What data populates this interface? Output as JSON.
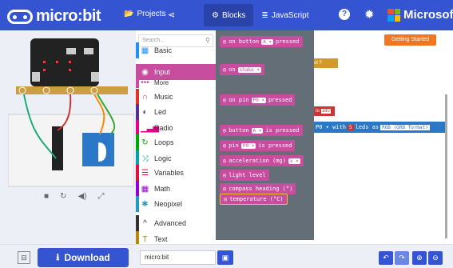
{
  "header": {
    "brand": "micro:bit",
    "projects_label": "Projects",
    "share_icon": "share-icon",
    "modes": [
      {
        "label": "Blocks",
        "active": true
      },
      {
        "label": "JavaScript",
        "active": false
      }
    ],
    "help_icon": "help-icon",
    "settings_icon": "gear-icon",
    "partner": "Microsoft",
    "accent": "#3454d1"
  },
  "toolbox": {
    "search_placeholder": "Search...",
    "categories": [
      {
        "label": "Basic",
        "color": "#1e90ff",
        "icon": "grid-icon"
      },
      {
        "label": "Input",
        "color": "#c94d9e",
        "icon": "target-icon",
        "active": true
      },
      {
        "label": "More",
        "color": "#c94d9e",
        "icon": "dots-icon"
      },
      {
        "label": "Music",
        "color": "#e63022",
        "icon": "headphones-icon"
      },
      {
        "label": "Led",
        "color": "#5c2d91",
        "icon": "toggle-icon"
      },
      {
        "label": "Radio",
        "color": "#e3008c",
        "icon": "bars-icon"
      },
      {
        "label": "Loops",
        "color": "#00aa00",
        "icon": "refresh-icon"
      },
      {
        "label": "Logic",
        "color": "#00a4a6",
        "icon": "shuffle-icon"
      },
      {
        "label": "Variables",
        "color": "#dc143c",
        "icon": "list-icon"
      },
      {
        "label": "Math",
        "color": "#9400d3",
        "icon": "calculator-icon"
      },
      {
        "label": "Neopixel",
        "color": "#2699bf",
        "icon": "spinner-icon"
      },
      {
        "label": "Advanced",
        "color": "#333333",
        "icon": "chevron-up-icon"
      },
      {
        "label": "Text",
        "color": "#b8860b",
        "icon": "text-icon"
      }
    ]
  },
  "flyout": {
    "blocks": [
      {
        "text": "on button",
        "chip": "A ▾",
        "suffix": "pressed"
      },
      {
        "text": "on",
        "chip": "shake ▾",
        "suffix": ""
      },
      {
        "text": "on pin",
        "chip": "P0 ▾",
        "suffix": "pressed"
      },
      {
        "text": "button",
        "chip": "A ▾",
        "suffix": "is pressed"
      },
      {
        "text": "pin",
        "chip": "P0 ▾",
        "suffix": "is pressed"
      },
      {
        "text": "acceleration (mg)",
        "chip": "x ▾",
        "suffix": ""
      },
      {
        "text": "light level",
        "chip": "",
        "suffix": ""
      },
      {
        "text": "compass heading (°)",
        "chip": "",
        "suffix": ""
      },
      {
        "text": "temperature (°C)",
        "chip": "",
        "suffix": ""
      }
    ]
  },
  "workspace": {
    "getting_started": "Getting Started",
    "block_text": "P0 ▾ with",
    "block_chip": "5",
    "block_suffix": "leds as",
    "block_format": "RGB (GRB format)",
    "stub1": "ol ?",
    "stub2": "to",
    "stub2_val": "180"
  },
  "footer": {
    "download_label": "Download",
    "project_name": "micro:bit"
  }
}
